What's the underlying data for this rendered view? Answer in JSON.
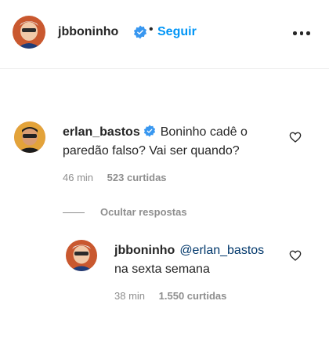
{
  "header": {
    "username": "jbboninho",
    "separator": "•",
    "follow_label": "Seguir",
    "avatar_icon": "profile-photo",
    "more_icon": "more-options-icon"
  },
  "comment": {
    "username": "erlan_bastos",
    "text": "Boninho cadê o paredão falso? Vai ser quando?",
    "time": "46 min",
    "likes": "523 curtidas"
  },
  "replies_toggle": {
    "label": "Ocultar respostas"
  },
  "reply": {
    "username": "jbboninho",
    "mention": "@erlan_bastos",
    "text": "na sexta semana",
    "time": "38 min",
    "likes": "1.550 curtidas"
  },
  "colors": {
    "accent": "#0095f6",
    "verified": "#3897f0",
    "mention": "#00376b",
    "muted": "#8e8e8e",
    "text": "#262626"
  }
}
